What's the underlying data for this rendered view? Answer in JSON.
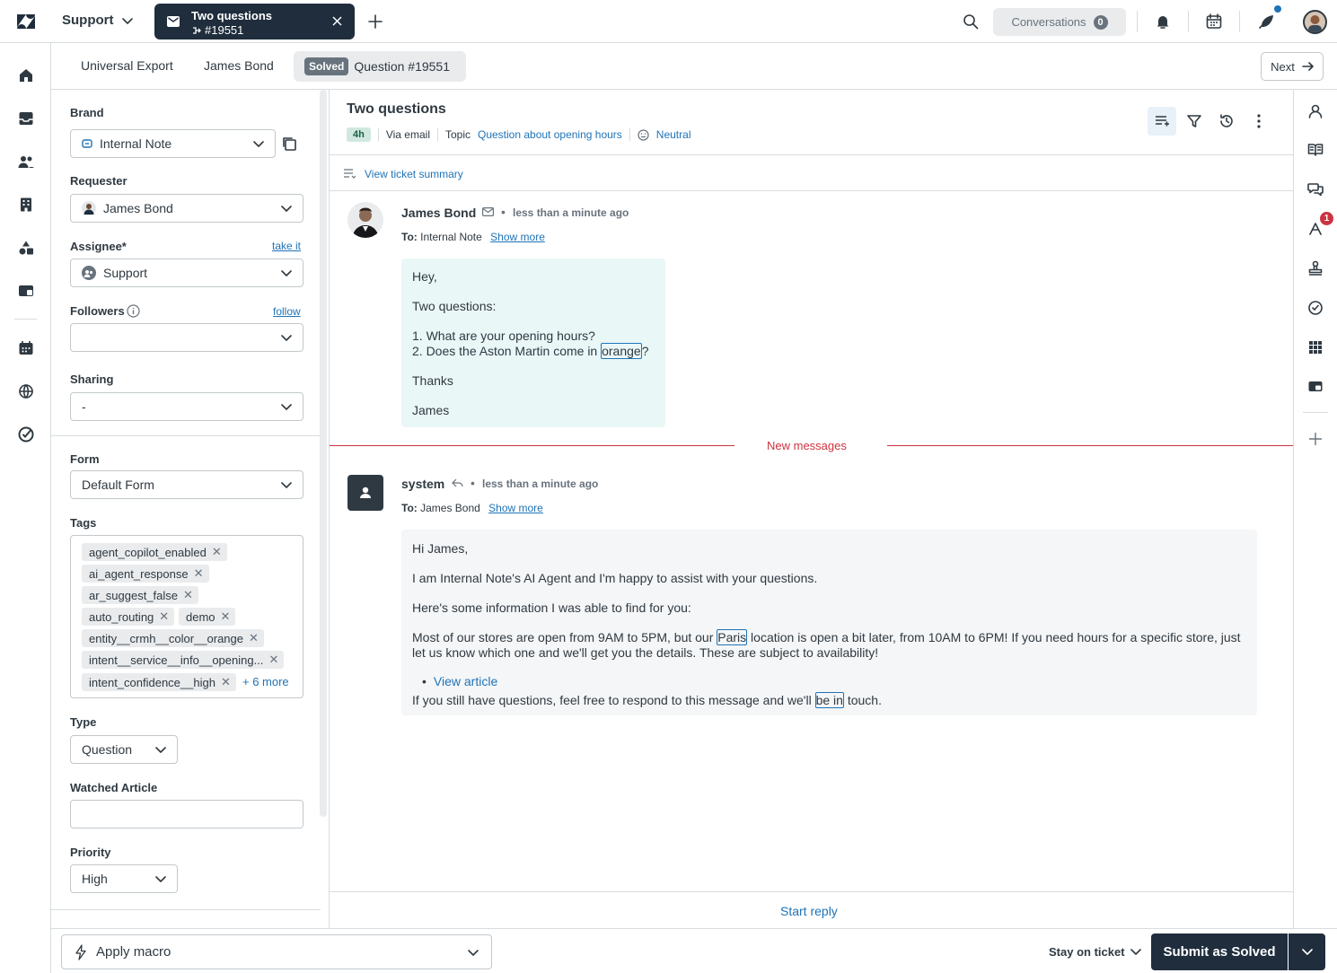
{
  "topbar": {
    "product": "Support",
    "ticket_tab": {
      "title": "Two questions",
      "id": "#19551"
    },
    "conversations_label": "Conversations",
    "conversations_count": "0"
  },
  "breadcrumbs": {
    "items": [
      "Universal Export",
      "James Bond"
    ],
    "status_badge": "Solved",
    "current": "Question #19551",
    "next_label": "Next"
  },
  "properties": {
    "brand_label": "Brand",
    "brand_value": "Internal Note",
    "requester_label": "Requester",
    "requester_value": "James Bond",
    "assignee_label": "Assignee*",
    "assignee_link": "take it",
    "assignee_value": "Support",
    "followers_label": "Followers",
    "followers_link": "follow",
    "followers_value": "",
    "sharing_label": "Sharing",
    "sharing_value": "-",
    "form_label": "Form",
    "form_value": "Default Form",
    "tags_label": "Tags",
    "tags": [
      "agent_copilot_enabled",
      "ai_agent_response",
      "ar_suggest_false",
      "auto_routing",
      "demo",
      "entity__crmh__color__orange",
      "intent__service__info__opening...",
      "intent_confidence__high"
    ],
    "tags_more": "+ 6 more",
    "type_label": "Type",
    "type_value": "Question",
    "watched_label": "Watched Article",
    "watched_value": "",
    "priority_label": "Priority",
    "priority_value": "High"
  },
  "ticket": {
    "title": "Two questions",
    "sla": "4h",
    "channel": "Via email",
    "topic_label": "Topic",
    "topic_value": "Question about opening hours",
    "sentiment": "Neutral",
    "summary_link": "View ticket summary",
    "new_messages": "New messages",
    "start_reply": "Start reply",
    "messages": [
      {
        "author": "James Bond",
        "time": "less than a minute ago",
        "to_label": "To:",
        "to": "Internal Note",
        "show_more": "Show more",
        "lines": [
          "Hey,",
          "Two questions:",
          "1. What are your opening hours?",
          "2. Does the Aston Martin come in ",
          "orange",
          "?",
          "Thanks",
          "James"
        ]
      },
      {
        "author": "system",
        "time": "less than a minute ago",
        "to_label": "To:",
        "to": "James Bond",
        "show_more": "Show more",
        "greeting": "Hi James,",
        "intro": "I am Internal Note's AI Agent and I'm happy to assist with your questions.",
        "info": "Here's some information I was able to find for you:",
        "body_a": "Most of our stores are open from 9AM to 5PM, but our ",
        "body_hl": "Paris",
        "body_b": " location is open a bit later, from 10AM to 6PM! If you need hours for a specific store, just let us know which one and we'll get you the details. These are subject to availability!",
        "article_link": "View article",
        "closing_a": "If you still have questions, feel free to respond to this message and we'll ",
        "closing_hl": "be in",
        "closing_b": " touch."
      }
    ]
  },
  "right_rail": {
    "badge_count": "1"
  },
  "bottom": {
    "macro_label": "Apply macro",
    "stay_label": "Stay on ticket",
    "submit_label": "Submit as Solved"
  },
  "colors": {
    "accent": "#1f73b7",
    "dark": "#1f2d3d",
    "new_messages": "#cc3340",
    "requester_bubble": "#eaf7f7",
    "agent_bubble": "#f5f6f7"
  }
}
